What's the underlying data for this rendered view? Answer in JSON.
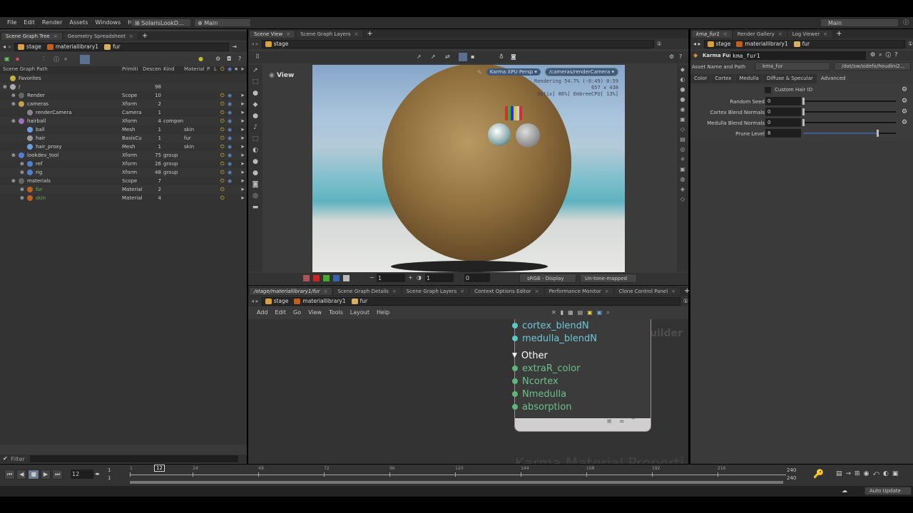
{
  "menubar": {
    "items": [
      "File",
      "Edit",
      "Render",
      "Assets",
      "Windows",
      "Help"
    ],
    "desktop": "SolarisLookD...",
    "context": "Main",
    "right_context": "Main"
  },
  "left": {
    "tabs": [
      "Scene Graph Tree",
      "Geometry Spreadsheet"
    ],
    "path": [
      "stage",
      "materiallibrary1",
      "fur"
    ],
    "columns": [
      "Scene Graph Path",
      "Primiti",
      "Descen",
      "Kind",
      "Material",
      "P",
      "L"
    ],
    "rows": [
      {
        "name": "Favorites",
        "type": "",
        "desc": "",
        "kind": "",
        "mat": "",
        "depth": 0,
        "color": "#ccc",
        "icon": "#c8b040",
        "flags": false
      },
      {
        "name": "/",
        "type": "",
        "desc": "98",
        "kind": "",
        "mat": "",
        "depth": 0,
        "color": "#ccc",
        "icon": "#aaa",
        "flags": false
      },
      {
        "name": "Render",
        "type": "Scope",
        "desc": "10",
        "kind": "",
        "mat": "",
        "depth": 1,
        "color": "#ccc",
        "icon": "#666",
        "flags": true
      },
      {
        "name": "cameras",
        "type": "Xform",
        "desc": "2",
        "kind": "",
        "mat": "",
        "depth": 1,
        "color": "#ccc",
        "icon": "#c8a040",
        "flags": true
      },
      {
        "name": "renderCamera",
        "type": "Camera",
        "desc": "1",
        "kind": "",
        "mat": "",
        "depth": 2,
        "color": "#ccc",
        "icon": "#888",
        "flags": true
      },
      {
        "name": "hairball",
        "type": "Xform",
        "desc": "4",
        "kind": "compon",
        "mat": "",
        "depth": 1,
        "color": "#ccc",
        "icon": "#a070c0",
        "flags": true
      },
      {
        "name": "ball",
        "type": "Mesh",
        "desc": "1",
        "kind": "",
        "mat": "skin",
        "depth": 2,
        "color": "#ccc",
        "icon": "#6aa0e0",
        "flags": true
      },
      {
        "name": "hair",
        "type": "BasisCu",
        "desc": "1",
        "kind": "",
        "mat": "fur",
        "depth": 2,
        "color": "#ccc",
        "icon": "#999",
        "flags": true
      },
      {
        "name": "hair_proxy",
        "type": "Mesh",
        "desc": "1",
        "kind": "",
        "mat": "skin",
        "depth": 2,
        "color": "#ccc",
        "icon": "#6aa0e0",
        "flags": true
      },
      {
        "name": "lookdev_tool",
        "type": "Xform",
        "desc": "75",
        "kind": "group",
        "mat": "",
        "depth": 1,
        "color": "#ccc",
        "icon": "#5080d0",
        "flags": true
      },
      {
        "name": "ref",
        "type": "Xform",
        "desc": "26",
        "kind": "group",
        "mat": "",
        "depth": 2,
        "color": "#ccc",
        "icon": "#5080d0",
        "flags": true
      },
      {
        "name": "rig",
        "type": "Xform",
        "desc": "48",
        "kind": "group",
        "mat": "",
        "depth": 2,
        "color": "#ccc",
        "icon": "#5080d0",
        "flags": true
      },
      {
        "name": "materials",
        "type": "Scope",
        "desc": "7",
        "kind": "",
        "mat": "",
        "depth": 1,
        "color": "#ccc",
        "icon": "#666",
        "flags": true
      },
      {
        "name": "fur",
        "type": "Material",
        "desc": "2",
        "kind": "",
        "mat": "",
        "depth": 2,
        "color": "#6ab04c",
        "icon": "#c06020",
        "flags": false
      },
      {
        "name": "skin",
        "type": "Material",
        "desc": "4",
        "kind": "",
        "mat": "",
        "depth": 2,
        "color": "#6ab04c",
        "icon": "#c06020",
        "flags": false
      }
    ],
    "filter_label": "Filter"
  },
  "viewer": {
    "tabs": [
      "Scene View",
      "Scene Graph Layers"
    ],
    "path": "stage",
    "view_label": "View",
    "renderer": "Karma XPU Persp",
    "camera": "/cameras/renderCamera",
    "overlay": [
      "Rendering  54.7%  (-0:49)  0:59",
      "657 x 438",
      "Optix[ 86%] EmbreeCPU[ 13%]"
    ],
    "exposure": "1",
    "gamma": "1",
    "offset": "0",
    "colorspace": "sRGB - Display",
    "tonemap": "Un-tone-mapped"
  },
  "network": {
    "tabs": [
      "/stage/materiallibrary1/fur",
      "Scene Graph Details",
      "Scene Graph Layers",
      "Context Options Editor",
      "Performance Monitor",
      "Clone Control Panel"
    ],
    "path": [
      "stage",
      "materiallibrary1",
      "fur"
    ],
    "menu": [
      "Add",
      "Edit",
      "Go",
      "View",
      "Tools",
      "Layout",
      "Help"
    ],
    "context_label": "VEX Builder",
    "watermark": "Karma Material Properti",
    "ports_top": [
      "cortex_blendN",
      "medulla_blendN"
    ],
    "group": "Other",
    "ports_other": [
      "extraR_color",
      "Ncortex",
      "Nmedulla",
      "absorption"
    ]
  },
  "params": {
    "tabs": [
      "kma_fur1",
      "Render Gallery",
      "Log Viewer"
    ],
    "path": [
      "stage",
      "materiallibrary1",
      "fur"
    ],
    "node_type": "Karma Fur",
    "node_name": "kma_fur1",
    "asset_label": "Asset Name and Path",
    "asset_name": "kma_fur",
    "asset_path": "/dat/sw/sidefx/houdini2...",
    "subtabs": [
      "Color",
      "Cortex",
      "Medulla",
      "Diffuse & Specular",
      "Advanced"
    ],
    "custom_hair_id": "Custom Hair ID",
    "fields": [
      {
        "label": "Random Seed",
        "value": "0",
        "fill": 0
      },
      {
        "label": "Cortex Blend Normals",
        "value": "0",
        "fill": 0
      },
      {
        "label": "Medulla Blend Normals",
        "value": "0",
        "fill": 0
      },
      {
        "label": "Prune Level",
        "value": "8",
        "fill": 0.8
      }
    ]
  },
  "timeline": {
    "frame": "12",
    "start": "1",
    "start2": "1",
    "end": "240",
    "end2": "240",
    "ticks": [
      "1",
      "24",
      "48",
      "72",
      "96",
      "120",
      "144",
      "168",
      "192",
      "216"
    ],
    "current": "12",
    "auto_update": "Auto Update"
  }
}
